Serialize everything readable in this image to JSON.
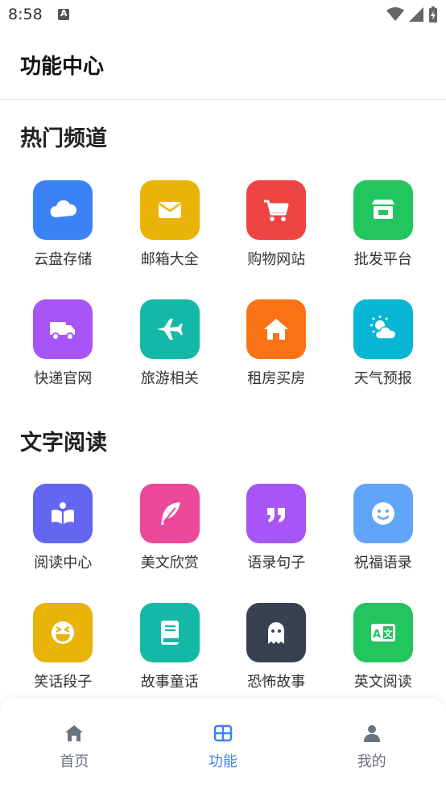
{
  "status_bar": {
    "time": "8:58"
  },
  "header": {
    "title": "功能中心"
  },
  "sections": [
    {
      "title": "热门频道",
      "items": [
        {
          "label": "云盘存储",
          "icon": "cloud-icon",
          "color": "#3B82F6"
        },
        {
          "label": "邮箱大全",
          "icon": "mail-icon",
          "color": "#EAB308"
        },
        {
          "label": "购物网站",
          "icon": "cart-icon",
          "color": "#EF4444"
        },
        {
          "label": "批发平台",
          "icon": "store-icon",
          "color": "#22C55E"
        },
        {
          "label": "快递官网",
          "icon": "truck-icon",
          "color": "#A855F7"
        },
        {
          "label": "旅游相关",
          "icon": "plane-icon",
          "color": "#14B8A6"
        },
        {
          "label": "租房买房",
          "icon": "house-icon",
          "color": "#F97316"
        },
        {
          "label": "天气预报",
          "icon": "weather-icon",
          "color": "#06B6D4"
        }
      ]
    },
    {
      "title": "文字阅读",
      "items": [
        {
          "label": "阅读中心",
          "icon": "book-reader-icon",
          "color": "#6366F1"
        },
        {
          "label": "美文欣赏",
          "icon": "feather-icon",
          "color": "#EC4899"
        },
        {
          "label": "语录句子",
          "icon": "quote-icon",
          "color": "#A855F7"
        },
        {
          "label": "祝福语录",
          "icon": "smile-icon",
          "color": "#60A5FA"
        },
        {
          "label": "笑话段子",
          "icon": "laugh-icon",
          "color": "#EAB308"
        },
        {
          "label": "故事童话",
          "icon": "storybook-icon",
          "color": "#14B8A6"
        },
        {
          "label": "恐怖故事",
          "icon": "ghost-icon",
          "color": "#374151"
        },
        {
          "label": "英文阅读",
          "icon": "translate-icon",
          "color": "#22C55E"
        }
      ]
    }
  ],
  "bottom_nav": {
    "items": [
      {
        "label": "首页",
        "icon": "home-icon",
        "active": false
      },
      {
        "label": "功能",
        "icon": "grid-icon",
        "active": true
      },
      {
        "label": "我的",
        "icon": "user-icon",
        "active": false
      }
    ],
    "active_color": "#3B82F6",
    "inactive_color": "#6B7280"
  }
}
